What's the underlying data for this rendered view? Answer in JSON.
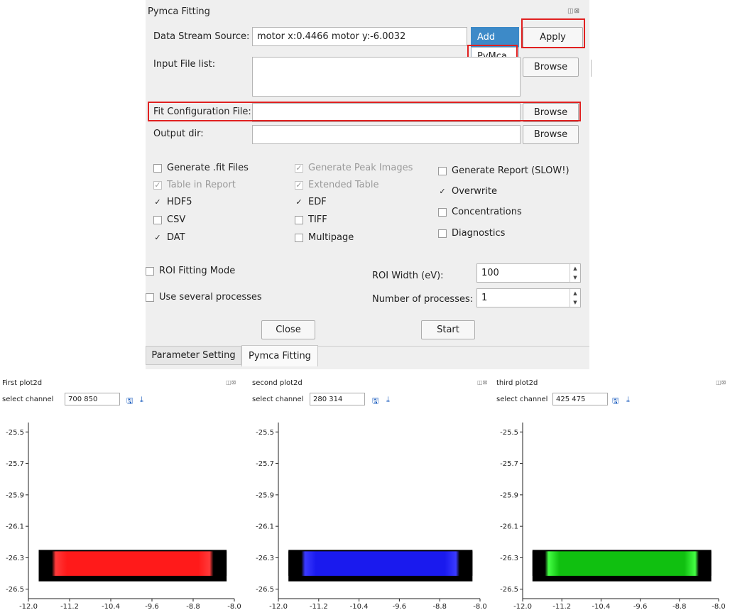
{
  "window": {
    "title": "Pymca Fitting"
  },
  "data_stream": {
    "label": "Data Stream Source:",
    "value": "motor x:0.4466   motor y:-6.0032",
    "add_label": "Add",
    "apply_label": "Apply",
    "dropdown_option": "PyMca"
  },
  "input_files": {
    "label": "Input File list:",
    "browse_label": "Browse"
  },
  "fit_config": {
    "label": "Fit Configuration File:",
    "value": "",
    "browse_label": "Browse"
  },
  "output_dir": {
    "label": "Output dir:",
    "value": "",
    "browse_label": "Browse"
  },
  "options": {
    "col1": [
      {
        "label": "Generate .fit Files",
        "checked": false,
        "disabled": false
      },
      {
        "label": "Table in Report",
        "checked": true,
        "disabled": true
      },
      {
        "label": "HDF5",
        "checked": true,
        "disabled": false
      },
      {
        "label": "CSV",
        "checked": false,
        "disabled": false
      },
      {
        "label": "DAT",
        "checked": true,
        "disabled": false
      }
    ],
    "col2": [
      {
        "label": "Generate Peak Images",
        "checked": true,
        "disabled": true
      },
      {
        "label": "Extended Table",
        "checked": true,
        "disabled": true
      },
      {
        "label": "EDF",
        "checked": true,
        "disabled": false
      },
      {
        "label": "TIFF",
        "checked": false,
        "disabled": false
      },
      {
        "label": "Multipage",
        "checked": false,
        "disabled": false
      }
    ],
    "col3": [
      {
        "label": "Generate Report (SLOW!)",
        "checked": false,
        "disabled": false
      },
      {
        "label": "Overwrite",
        "checked": true,
        "disabled": false
      },
      {
        "label": "Concentrations",
        "checked": false,
        "disabled": false
      },
      {
        "label": "Diagnostics",
        "checked": false,
        "disabled": false
      }
    ]
  },
  "roi": {
    "mode_label": "ROI Fitting Mode",
    "several_label": "Use several processes",
    "width_label": "ROI Width (eV):",
    "width_value": "100",
    "processes_label": "Number of processes:",
    "processes_value": "1"
  },
  "actions": {
    "close_label": "Close",
    "start_label": "Start"
  },
  "tabs": [
    {
      "label": "Parameter Setting",
      "active": false
    },
    {
      "label": "Pymca Fitting",
      "active": true
    }
  ],
  "plots": [
    {
      "title": "First plot2d",
      "select_label": "select channel",
      "channel": "700 850",
      "color": "#ff1a1a",
      "edge": "#ff3a3a"
    },
    {
      "title": "second plot2d",
      "select_label": "select channel",
      "channel": "280 314",
      "color": "#1a1aee",
      "edge": "#3a3aff"
    },
    {
      "title": "third plot2d",
      "select_label": "select channel",
      "channel": "425 475",
      "color": "#10c010",
      "edge": "#44ff44"
    }
  ],
  "plot_axes": {
    "y_ticks": [
      "-25.5",
      "-25.7",
      "-25.9",
      "-26.1",
      "-26.3",
      "-26.5"
    ],
    "x_ticks": [
      "-12.0",
      "-11.2",
      "-10.4",
      "-9.6",
      "-8.8",
      "-8.0"
    ],
    "xlim": [
      -12.0,
      -8.0
    ],
    "ylim": [
      -26.56,
      -25.44
    ]
  },
  "chart_data": [
    {
      "type": "heatmap",
      "title": "First plot2d",
      "xlim": [
        -12.0,
        -8.0
      ],
      "ylim": [
        -26.56,
        -25.44
      ],
      "extent": {
        "x": [
          -11.8,
          -8.15
        ],
        "y": [
          -26.45,
          -26.25
        ]
      },
      "color": "red"
    },
    {
      "type": "heatmap",
      "title": "second plot2d",
      "xlim": [
        -12.0,
        -8.0
      ],
      "ylim": [
        -26.56,
        -25.44
      ],
      "extent": {
        "x": [
          -11.8,
          -8.15
        ],
        "y": [
          -26.45,
          -26.25
        ]
      },
      "color": "blue"
    },
    {
      "type": "heatmap",
      "title": "third plot2d",
      "xlim": [
        -12.0,
        -8.0
      ],
      "ylim": [
        -26.56,
        -25.44
      ],
      "extent": {
        "x": [
          -11.8,
          -8.15
        ],
        "y": [
          -26.45,
          -26.25
        ]
      },
      "color": "green"
    }
  ]
}
